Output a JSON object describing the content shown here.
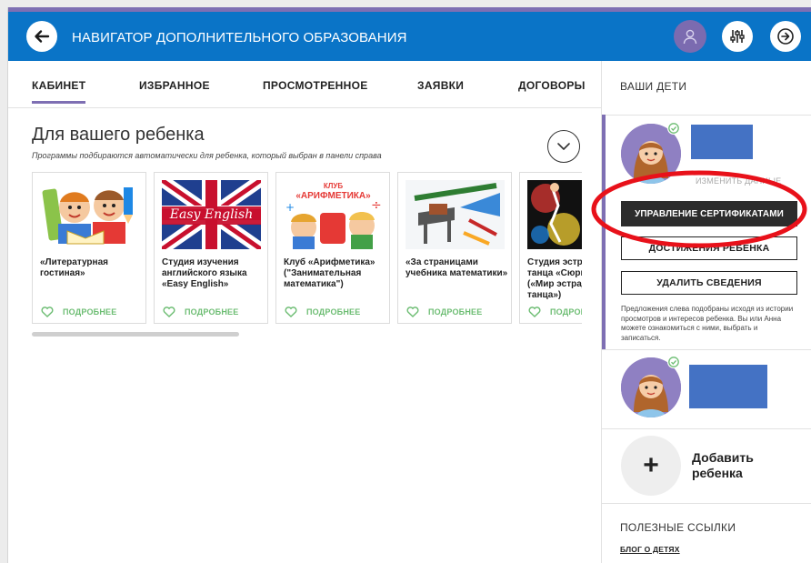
{
  "header": {
    "title": "НАВИГАТОР ДОПОЛНИТЕЛЬНОГО ОБРАЗОВАНИЯ",
    "icons": [
      "arrow-left-icon",
      "user-icon",
      "sliders-icon",
      "exit-icon"
    ]
  },
  "tabs": [
    {
      "label": "КАБИНЕТ",
      "active": true
    },
    {
      "label": "ИЗБРАННОЕ",
      "active": false
    },
    {
      "label": "ПРОСМОТРЕННОЕ",
      "active": false
    },
    {
      "label": "ЗАЯВКИ",
      "active": false
    },
    {
      "label": "ДОГОВОРЫ",
      "active": false
    }
  ],
  "main": {
    "title": "Для вашего ребенка",
    "subtitle": "Программы подбираются автоматически для ребенка, который выбран в панели справа",
    "cards": [
      {
        "title": "«Литературная гостиная»",
        "more": "ПОДРОБНЕЕ"
      },
      {
        "title": "Студия изучения английского языка «Easy English»",
        "image_text": "Easy English",
        "more": "ПОДРОБНЕЕ"
      },
      {
        "title": "Клуб «Арифметика» (\"Занимательная математика\")",
        "image_text_top": "КЛУБ",
        "image_text": "«АРИФМЕТИКА»",
        "more": "ПОДРОБНЕЕ"
      },
      {
        "title": "«За страницами учебника математики»",
        "more": "ПОДРОБНЕЕ"
      },
      {
        "title": "Студия эстрадного танца «Сюрприз» («Мир эстрадного танца»)",
        "more": "ПОДРОБНЕЕ"
      }
    ]
  },
  "sidebar": {
    "heading": "ВАШИ ДЕТИ",
    "child1": {
      "change_link": "ИЗМЕНИТЬ ДАННЫЕ",
      "manage_certificates": "УПРАВЛЕНИЕ СЕРТИФИКАТАМИ",
      "achievements": "ДОСТИЖЕНИЯ РЕБЕНКА",
      "delete": "УДАЛИТЬ СВЕДЕНИЯ",
      "note": "Предложения слева подобраны исходя из истории просмотров и интересов ребенка. Вы или Анна можете ознакомиться с ними, выбрать и записаться."
    },
    "add_child": {
      "icon": "+",
      "label": "Добавить ребенка"
    },
    "links_heading": "ПОЛЕЗНЫЕ ССЫЛКИ",
    "blog_link": "БЛОГ О ДЕТЯХ"
  },
  "colors": {
    "header_blue": "#0a74c7",
    "accent_purple": "#7e6fb3",
    "more_green": "#6dbd73",
    "redacted_blue": "#4472c4",
    "annotation_red": "#e8111a"
  }
}
